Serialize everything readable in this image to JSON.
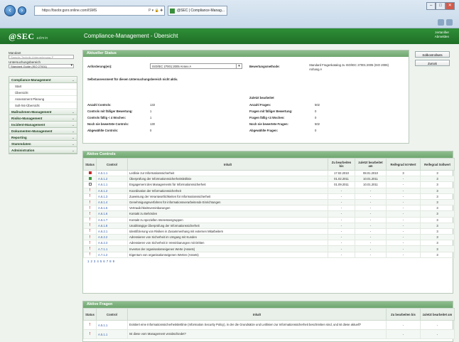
{
  "browser": {
    "url": "https://bsobr.gsnr.online.com/ISMS",
    "tab_title": "@SEC | Compliance-Manag...",
    "addr_tools": "P ▾ 🔒 ✚ ✕"
  },
  "header": {
    "logo": "@SEC",
    "logo_sub": "admin",
    "title": "Compliance-Management - Übersicht",
    "user_line1": "zertanifier",
    "user_line2": "Abmelden"
  },
  "sidebar": {
    "mandant_label": "Mandant",
    "mandant_value": "Sample-Technik-Unternehmung-P",
    "bereich_label": "Untersuchungsbereich",
    "bereich_value": "Standard-Guide (ISO 27001)",
    "menu": [
      {
        "label": "Compliance-Management",
        "chev": "⌄",
        "sub": [
          "Start",
          "Übersicht",
          "Assessment Planung",
          "Soll-/Ist-Übersicht"
        ]
      },
      {
        "label": "Maßnahmen-Management",
        "chev": "⌄",
        "sub": []
      },
      {
        "label": "Risiko-Management",
        "chev": "⌄",
        "sub": []
      },
      {
        "label": "Incident-Management",
        "chev": "⌄",
        "sub": []
      },
      {
        "label": "Dokumenten-Management",
        "chev": "⌄",
        "sub": []
      },
      {
        "label": "Reporting",
        "chev": "⌄",
        "sub": []
      },
      {
        "label": "Stammdaten",
        "chev": "⌄",
        "sub": []
      },
      {
        "label": "Administration",
        "chev": "⌄",
        "sub": []
      }
    ]
  },
  "status": {
    "title": "Aktueller Status",
    "anforderung_label": "Anforderung(en):",
    "anforderung_value": "ISO/IEC 27001:2005 Annex A",
    "bewertung_label": "Bewertungsmethode:",
    "bewertung_value_1": "Standard Fragenkatalog zu ISO/IEC 27001:2005 (ISO 2006)",
    "bewertung_value_2": "Anhang A",
    "note": "Selbstassessment für diesen Untersuchungsbereich nicht aktiv.",
    "zuletzt_label": "Zuletzt bearbeitet",
    "left": [
      {
        "k": "Anzahl Controls:",
        "v": "133"
      },
      {
        "k": "Controls mit fälliger Bewertung:",
        "v": "1"
      },
      {
        "k": "Controls fällig < 4 Wochen:",
        "v": "1"
      },
      {
        "k": "Noch nie bewertete Controls:",
        "v": "130"
      },
      {
        "k": "Abgewählte Controls:",
        "v": "0"
      }
    ],
    "right": [
      {
        "k": "Anzahl Fragen:",
        "v": "502"
      },
      {
        "k": "Fragen mit fälliger Bewertung:",
        "v": "0"
      },
      {
        "k": "Fragen fällig <4 Wochen:",
        "v": "0"
      },
      {
        "k": "Noch nie bewertete Fragen:",
        "v": "502"
      },
      {
        "k": "Abgewählte Fragen:",
        "v": "0"
      }
    ],
    "btn_controls": "Sollkontrollsets",
    "btn_back": "Zurück"
  },
  "controls": {
    "title": "Aktive Controls",
    "headers": [
      "Status",
      "Control",
      "Inhalt",
      "Zu bearbeiten bis",
      "zuletzt bearbeitet am",
      "Reifegrad Ist-Wert",
      "Reifegrad Sollwert"
    ],
    "rows": [
      {
        "status": "red",
        "id": "A.5.1.1",
        "text": "Leitlinie zur Informationssicherheit",
        "bis": "17.02.2010",
        "am": "08.01.2010",
        "ist": "3",
        "soll": "3"
      },
      {
        "status": "green",
        "id": "A.5.1.2",
        "text": "Überprüfung der Informationssicherheitsleitlinie",
        "bis": "01.02.2011",
        "am": "10.01.2011",
        "ist": "-",
        "soll": "3"
      },
      {
        "status": "empty",
        "id": "A.6.1.1",
        "text": "Engagement des Managements für Informationssicherheit",
        "bis": "01.09.2011",
        "am": "10.01.2011",
        "ist": "-",
        "soll": "3"
      },
      {
        "status": "bang",
        "id": "A.6.1.2",
        "text": "Koordination der Informationssicherheit",
        "bis": "-",
        "am": "-",
        "ist": "-",
        "soll": "3"
      },
      {
        "status": "bang",
        "id": "A.6.1.3",
        "text": "Zuweisung der Verantwortlichkeiten für Informationssicherheit",
        "bis": "-",
        "am": "-",
        "ist": "-",
        "soll": "3"
      },
      {
        "status": "bang",
        "id": "A.6.1.4",
        "text": "Genehmigungsverfahren für informationsverarbeitende Einrichtungen",
        "bis": "-",
        "am": "-",
        "ist": "-",
        "soll": "3"
      },
      {
        "status": "bang",
        "id": "A.6.1.5",
        "text": "Vertraulichkeitsvereinbarungen",
        "bis": "-",
        "am": "-",
        "ist": "-",
        "soll": "3"
      },
      {
        "status": "bang",
        "id": "A.6.1.6",
        "text": "Kontakt zu Behörden",
        "bis": "-",
        "am": "-",
        "ist": "-",
        "soll": "3"
      },
      {
        "status": "bang",
        "id": "A.6.1.7",
        "text": "Kontakt zu speziellen Interessengruppen",
        "bis": "-",
        "am": "-",
        "ist": "-",
        "soll": "3"
      },
      {
        "status": "bang",
        "id": "A.6.1.8",
        "text": "Unabhängige Überprüfung der Informationssicherheit",
        "bis": "-",
        "am": "-",
        "ist": "-",
        "soll": "3"
      },
      {
        "status": "bang",
        "id": "A.6.2.1",
        "text": "Identifizierung von Risiken in Zusammenhang mit externen Mitarbeitern",
        "bis": "-",
        "am": "-",
        "ist": "-",
        "soll": "3"
      },
      {
        "status": "bang",
        "id": "A.6.2.2",
        "text": "Adressieren von Sicherheit im Umgang mit Kunden",
        "bis": "-",
        "am": "-",
        "ist": "-",
        "soll": "3"
      },
      {
        "status": "bang",
        "id": "A.6.2.3",
        "text": "Adressieren von Sicherheit in Vereinbarungen mit Dritten",
        "bis": "-",
        "am": "-",
        "ist": "-",
        "soll": "3"
      },
      {
        "status": "bang",
        "id": "A.7.1.1",
        "text": "Inventar der organisationseigenen Werte (Assets)",
        "bis": "-",
        "am": "-",
        "ist": "-",
        "soll": "3"
      },
      {
        "status": "bang",
        "id": "A.7.1.2",
        "text": "Eigentum von organisationseigenen Werten (Assets)",
        "bis": "-",
        "am": "-",
        "ist": "-",
        "soll": "3"
      }
    ],
    "pager": [
      "1",
      "2",
      "3",
      "4",
      "5",
      "6",
      "7",
      "8",
      "9"
    ]
  },
  "fragen": {
    "title": "Aktive Fragen",
    "headers": [
      "Status",
      "Control",
      "Inhalt",
      "Zu bearbeiten bis",
      "zuletzt bearbeitet am"
    ],
    "rows": [
      {
        "status": "bang",
        "id": "A.5.1.1",
        "text": "Existiert eine Informationssicherheitsleitlinie (Information Security Policy), in der die Grundsätze und Leitlinien zur Informationssicherheit beschrieben sind, und ist diese aktuell?",
        "bis": "-",
        "am": "-"
      },
      {
        "status": "bang",
        "id": "A.5.1.1",
        "text": "Ist diese vom Management verabschiedet?",
        "bis": "-",
        "am": "-"
      }
    ]
  }
}
